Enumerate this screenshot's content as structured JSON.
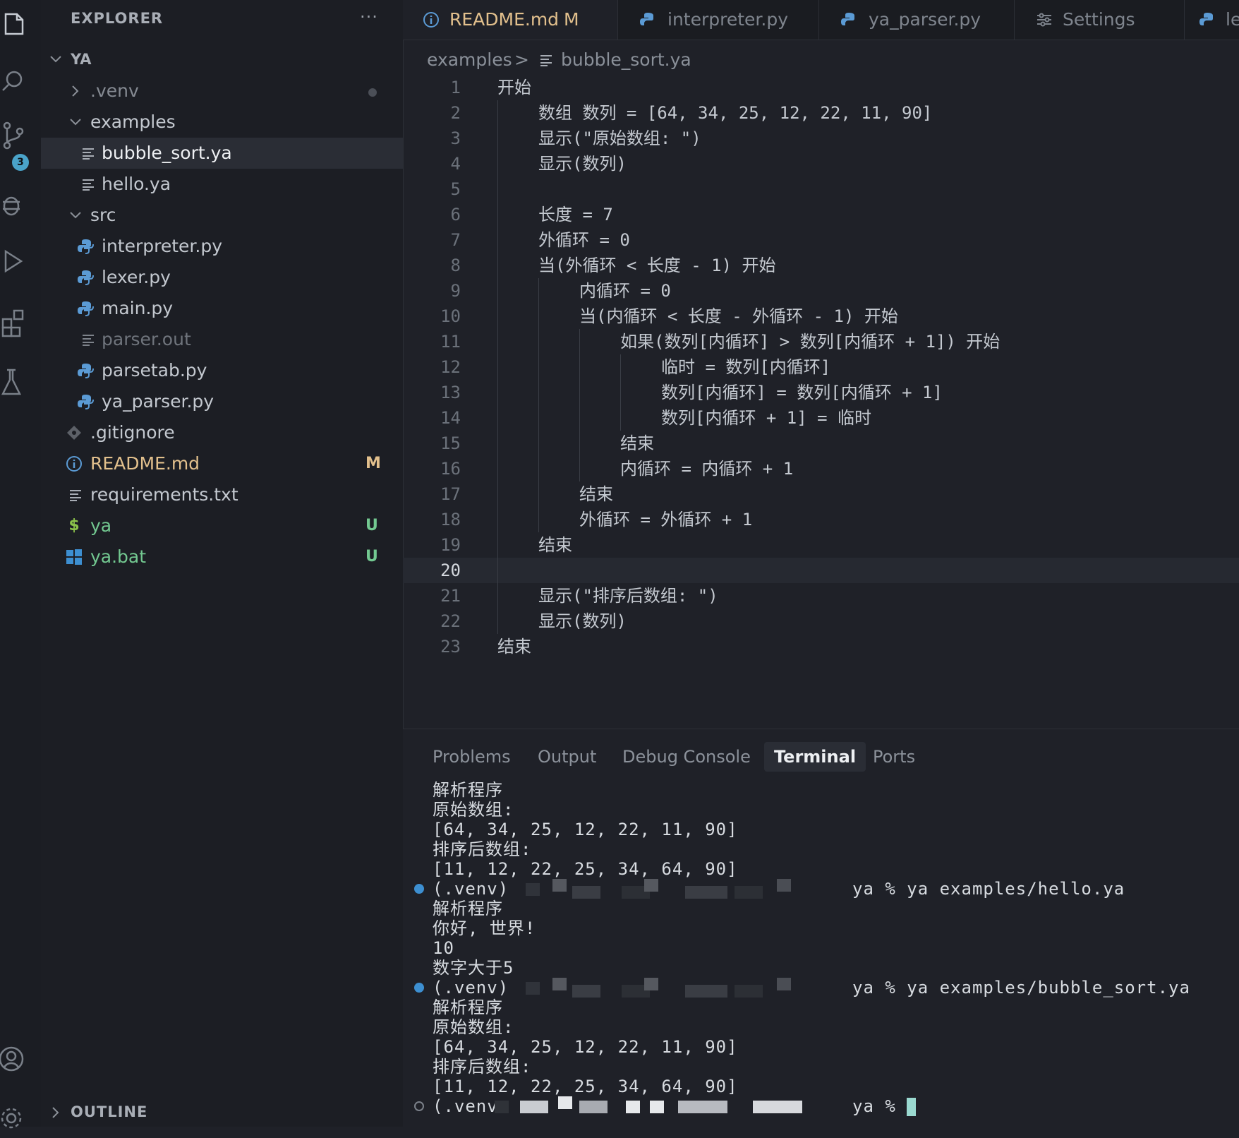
{
  "sidebar": {
    "title": "EXPLORER",
    "more": "···",
    "root": "YA",
    "items": [
      {
        "label": ".venv",
        "git": ""
      },
      {
        "label": "examples",
        "git": ""
      },
      {
        "label": "bubble_sort.ya",
        "git": ""
      },
      {
        "label": "hello.ya",
        "git": ""
      },
      {
        "label": "src",
        "git": ""
      },
      {
        "label": "interpreter.py",
        "git": ""
      },
      {
        "label": "lexer.py",
        "git": ""
      },
      {
        "label": "main.py",
        "git": ""
      },
      {
        "label": "parser.out",
        "git": ""
      },
      {
        "label": "parsetab.py",
        "git": ""
      },
      {
        "label": "ya_parser.py",
        "git": ""
      },
      {
        "label": ".gitignore",
        "git": ""
      },
      {
        "label": "README.md",
        "git": "M"
      },
      {
        "label": "requirements.txt",
        "git": ""
      },
      {
        "label": "ya",
        "git": "U"
      },
      {
        "label": "ya.bat",
        "git": "U"
      }
    ],
    "outline": "OUTLINE",
    "scm_badge": "3"
  },
  "tabs": [
    {
      "label": "README.md",
      "badge": "M"
    },
    {
      "label": "interpreter.py"
    },
    {
      "label": "ya_parser.py"
    },
    {
      "label": "Settings"
    },
    {
      "label": "le"
    }
  ],
  "breadcrumb": {
    "folder": "examples",
    "sep": ">",
    "file": "bubble_sort.ya"
  },
  "editor": {
    "lines": [
      "开始",
      "数组 数列 = [64, 34, 25, 12, 22, 11, 90]",
      "显示(\"原始数组: \")",
      "显示(数列)",
      "",
      "长度 = 7",
      "外循环 = 0",
      "当(外循环 < 长度 - 1) 开始",
      "内循环 = 0",
      "当(内循环 < 长度 - 外循环 - 1) 开始",
      "如果(数列[内循环] > 数列[内循环 + 1]) 开始",
      "临时 = 数列[内循环]",
      "数列[内循环] = 数列[内循环 + 1]",
      "数列[内循环 + 1] = 临时",
      "结束",
      "内循环 = 内循环 + 1",
      "结束",
      "外循环 = 外循环 + 1",
      "结束",
      "",
      "显示(\"排序后数组: \")",
      "显示(数列)",
      "结束"
    ],
    "line_numbers": [
      "1",
      "2",
      "3",
      "4",
      "5",
      "6",
      "7",
      "8",
      "9",
      "10",
      "11",
      "12",
      "13",
      "14",
      "15",
      "16",
      "17",
      "18",
      "19",
      "20",
      "21",
      "22",
      "23"
    ],
    "current_line": 20
  },
  "panel": {
    "tabs": [
      "Problems",
      "Output",
      "Debug Console",
      "Terminal",
      "Ports"
    ],
    "active_tab": "Terminal",
    "terminal": [
      "解析程序",
      "原始数组:",
      "[64, 34, 25, 12, 22, 11, 90]",
      "排序后数组:",
      "[11, 12, 22, 25, 34, 64, 90]",
      "(.venv)",
      "ya % ya examples/hello.ya",
      "解析程序",
      "你好, 世界!",
      "10",
      "数字大于5",
      "(.venv)",
      "ya % ya examples/bubble_sort.ya",
      "解析程序",
      "原始数组:",
      "[64, 34, 25, 12, 22, 11, 90]",
      "排序后数组:",
      "[11, 12, 22, 25, 34, 64, 90]",
      "(.venv",
      "ya %"
    ]
  },
  "colors": {
    "modified": "#e2c08d",
    "untracked": "#73c991",
    "accent_blue": "#3d8fd1"
  }
}
